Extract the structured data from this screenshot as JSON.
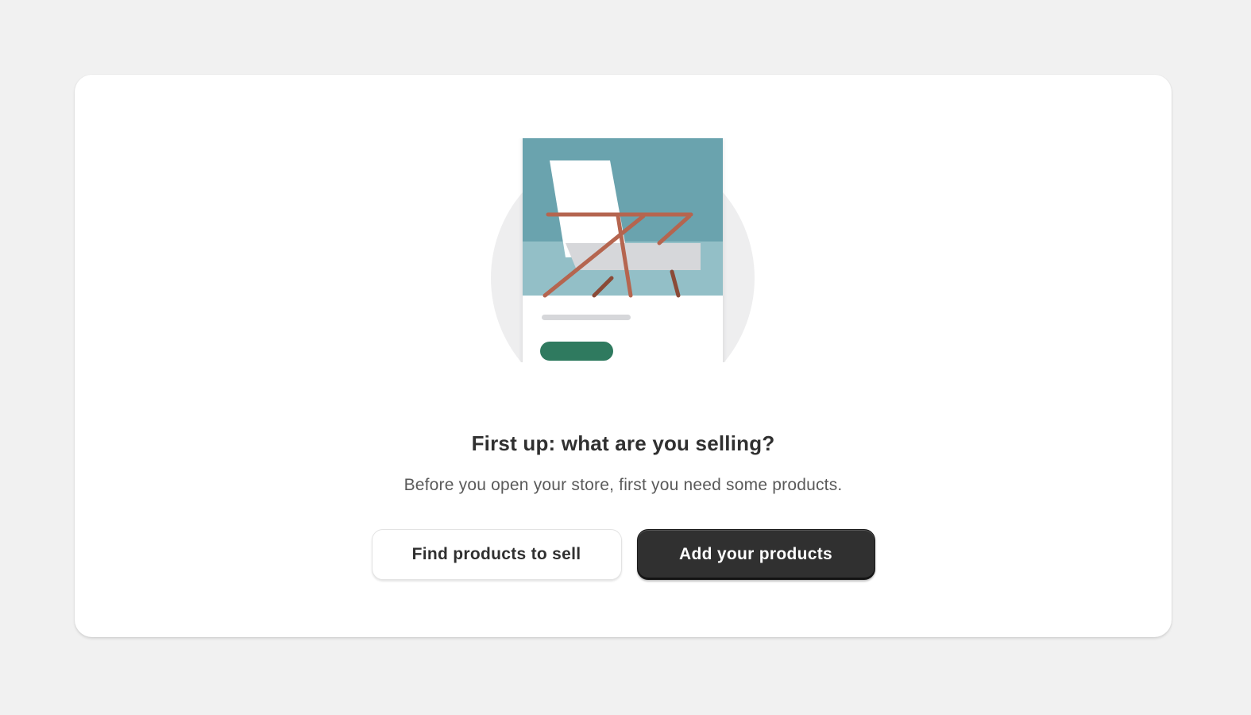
{
  "empty_state": {
    "illustration_icon": "product-chair-illustration",
    "title": "First up: what are you selling?",
    "subtitle": "Before you open your store, first you need some products.",
    "secondary_action_label": "Find products to sell",
    "primary_action_label": "Add your products"
  },
  "colors": {
    "page_background": "#f1f1f1",
    "card_background": "#ffffff",
    "primary_button": "#303030",
    "illustration_sky": "#6aa3ae",
    "illustration_floor": "#93bfc7",
    "illustration_chair_frame": "#b5654f",
    "illustration_cta": "#2f7a5f"
  }
}
